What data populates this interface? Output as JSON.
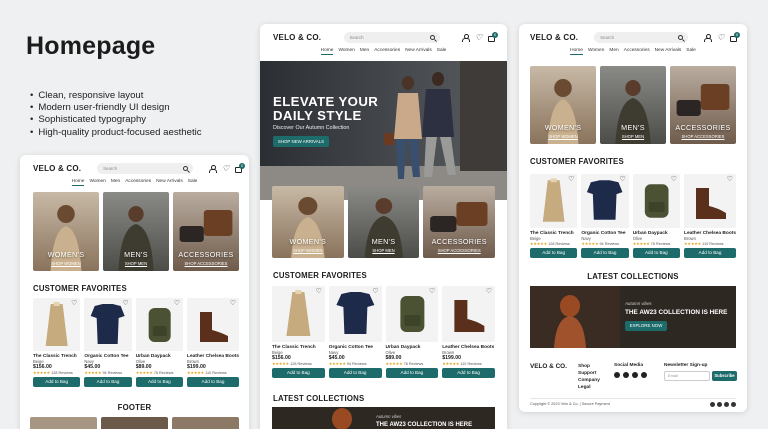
{
  "heading": "Homepage",
  "bullets": [
    "Clean, responsive layout",
    "Modern user-friendly UI design",
    "Sophisticated typography",
    "High-quality product-focused aesthetic"
  ],
  "brand": "VELO & CO.",
  "search_placeholder": "Search",
  "cart_count": "0",
  "nav": [
    "Home",
    "Women",
    "Men",
    "Accessories",
    "New Arrivals",
    "Sale"
  ],
  "hero": {
    "title_line1": "ELEVATE YOUR",
    "title_line2": "DAILY STYLE",
    "subtitle": "Discover Our Autumn Collection",
    "button": "SHOP NEW ARRIVALS"
  },
  "categories": [
    {
      "title": "WOMEN'S",
      "link": "SHOP WOMEN"
    },
    {
      "title": "MEN'S",
      "link": "SHOP MEN"
    },
    {
      "title": "ACCESSORIES",
      "link": "SHOP ACCESSORIES"
    }
  ],
  "favorites_title": "CUSTOMER FAVORITES",
  "products": [
    {
      "name": "The Classic Trench",
      "color": "Beige",
      "price": "$156.00",
      "stars": "★★★★★",
      "reviews": "128 Reviews"
    },
    {
      "name": "Organic Cotton Tee",
      "color": "Navy",
      "price": "$45.00",
      "stars": "★★★★★",
      "reviews": "94 Reviews"
    },
    {
      "name": "Urban Daypack",
      "color": "Olive",
      "price": "$89.00",
      "stars": "★★★★★",
      "reviews": "76 Reviews"
    },
    {
      "name": "Leather Chelsea Boots",
      "color": "Brown",
      "price": "$199.00",
      "stars": "★★★★★",
      "reviews": "110 Reviews"
    }
  ],
  "add_to_bag": "Add to Bag",
  "footer_title": "FOOTER",
  "latest_title": "LATEST COLLECTIONS",
  "banner": {
    "tag": "Autumn vibes",
    "title": "THE AW23 COLLECTION IS HERE",
    "button": "EXPLORE NOW"
  },
  "footer": {
    "links": [
      "Shop",
      "Support",
      "Company",
      "Legal"
    ],
    "social_title": "Social Media",
    "newsletter_title": "Newsletter Sign-up",
    "email_placeholder": "Email",
    "subscribe": "Subscribe",
    "copyright": "Copyright © 2023 Velo & Co. | Secure Payment"
  }
}
